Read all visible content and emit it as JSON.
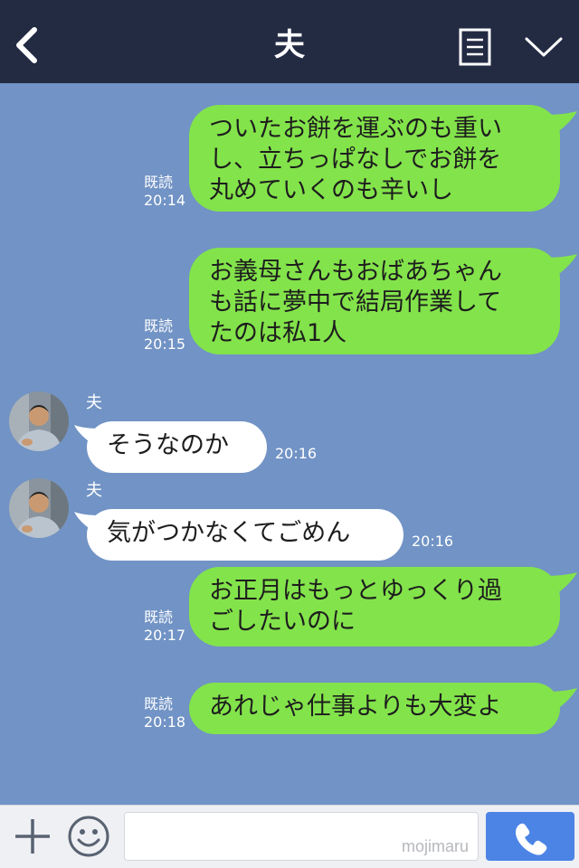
{
  "header": {
    "title": "夫",
    "back_icon": "back-chevron-icon",
    "menu_icon": "notes-menu-icon",
    "expand_icon": "chevron-down-icon"
  },
  "messages": [
    {
      "side": "out",
      "text_lines": [
        "ついたお餅を運ぶのも重い",
        "し、立ちっぱなしでお餅を",
        "丸めていくのも辛いし"
      ],
      "read": "既読",
      "time": "20:14"
    },
    {
      "side": "out",
      "text_lines": [
        "お義母さんもおばあちゃん",
        "も話に夢中で結局作業して",
        "たのは私1人"
      ],
      "read": "既読",
      "time": "20:15"
    },
    {
      "side": "in",
      "sender": "夫",
      "text_lines": [
        "そうなのか"
      ],
      "time": "20:16"
    },
    {
      "side": "in",
      "sender": "夫",
      "text_lines": [
        "気がつかなくてごめん"
      ],
      "time": "20:16"
    },
    {
      "side": "out",
      "text_lines": [
        "お正月はもっとゆっくり過",
        "ごしたいのに"
      ],
      "read": "既読",
      "time": "20:17"
    },
    {
      "side": "out",
      "text_lines": [
        "あれじゃ仕事よりも大変よ"
      ],
      "read": "既読",
      "time": "20:18"
    }
  ],
  "input_bar": {
    "placeholder": "",
    "watermark": "mojimaru",
    "plus_icon": "plus-icon",
    "emoji_icon": "smiley-icon",
    "call_icon": "phone-icon"
  },
  "colors": {
    "header_bg": "#232b43",
    "chat_bg": "#7193c5",
    "outgoing_bubble": "#83e34b",
    "incoming_bubble": "#ffffff",
    "call_button": "#4c84e6"
  }
}
